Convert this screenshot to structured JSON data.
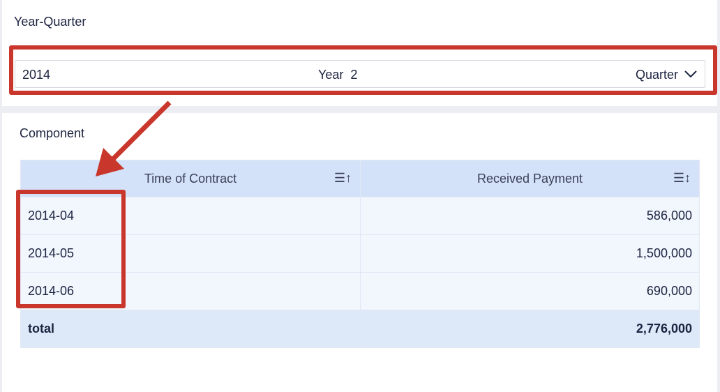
{
  "filter": {
    "label": "Year-Quarter",
    "year": "2014",
    "middle": "Year  2",
    "quarter": "Quarter"
  },
  "component": {
    "label": "Component",
    "columns": [
      "Time of Contract",
      "Received Payment"
    ],
    "rows": [
      {
        "time": "2014-04",
        "payment": "586,000"
      },
      {
        "time": "2014-05",
        "payment": "1,500,000"
      },
      {
        "time": "2014-06",
        "payment": "690,000"
      }
    ],
    "total": {
      "label": "total",
      "payment": "2,776,000"
    }
  },
  "colors": {
    "annotation": "#c9372c",
    "header": "#d3e2f8"
  }
}
